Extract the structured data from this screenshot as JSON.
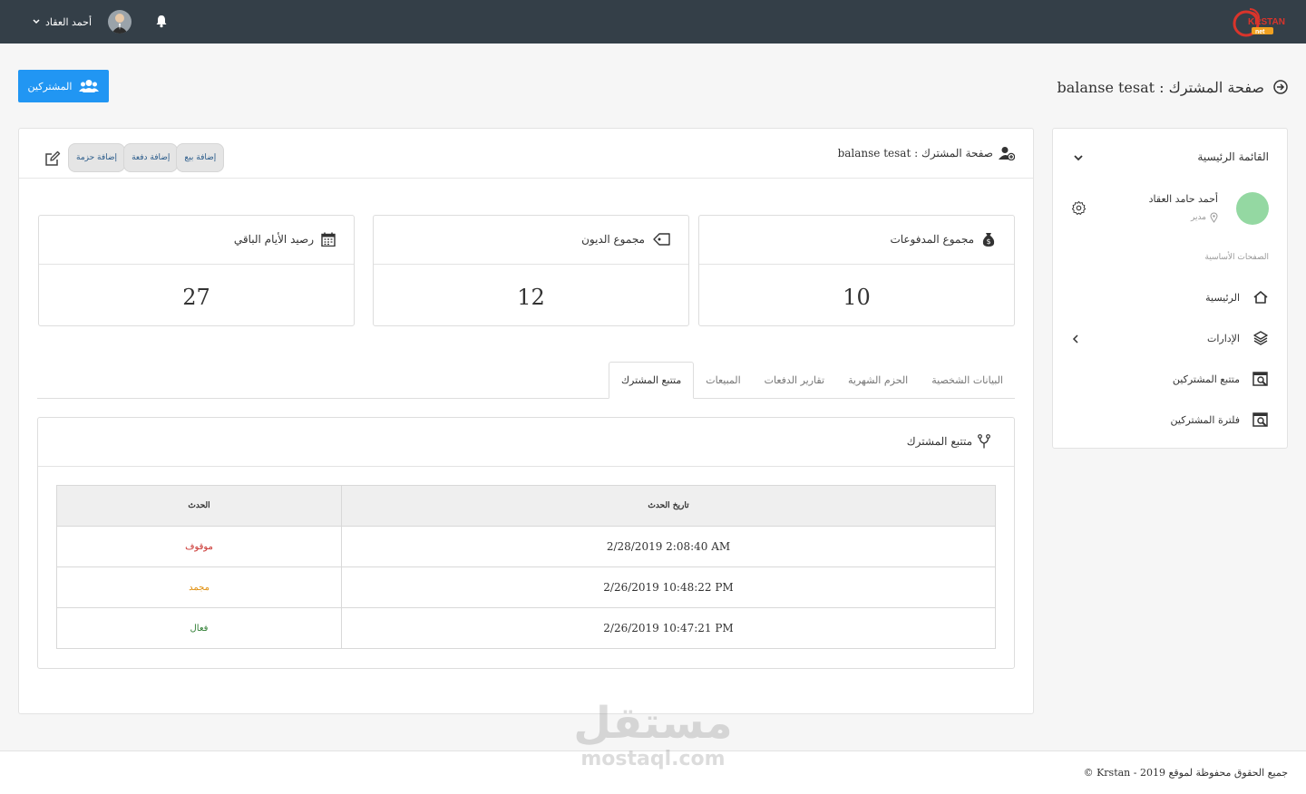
{
  "header": {
    "user_name": "أحمد العقاد",
    "logo_text": "KRSTAN",
    "logo_sub": "net"
  },
  "page": {
    "title": "صفحة المشترك : balanse tesat",
    "subscribers_button": "المشتركين"
  },
  "sidebar": {
    "heading": "القائمة الرئيسية",
    "user_name": "أحمد حامد العقاد",
    "user_role": "مدير",
    "section_label": "الصفحات الأساسية",
    "items": [
      {
        "label": "الرئيسية",
        "icon": "home-icon"
      },
      {
        "label": "الإدارات",
        "icon": "layers-icon"
      },
      {
        "label": "متتبع المشتركين",
        "icon": "search-box-icon"
      },
      {
        "label": "فلترة المشتركين",
        "icon": "search-box-icon"
      }
    ]
  },
  "main": {
    "title": "صفحة المشترك : balanse tesat",
    "actions": [
      "إضافة بيع",
      "إضافة دفعة",
      "إضافة حزمة"
    ]
  },
  "stats": [
    {
      "label": "مجموع المدفوعات",
      "value": "10",
      "icon": "money-bag-icon"
    },
    {
      "label": "مجموع الديون",
      "value": "12",
      "icon": "tag-icon"
    },
    {
      "label": "رصيد الأيام الباقي",
      "value": "27",
      "icon": "calendar-icon"
    }
  ],
  "tabs": [
    {
      "label": "البيانات الشخصية",
      "active": false
    },
    {
      "label": "الحزم الشهرية",
      "active": false
    },
    {
      "label": "تقارير الدفعات",
      "active": false
    },
    {
      "label": "المبيعات",
      "active": false
    },
    {
      "label": "متتبع المشترك",
      "active": true
    }
  ],
  "tracker": {
    "title": "متتبع المشترك",
    "columns": [
      "تاريخ الحدث",
      "الحدث"
    ],
    "rows": [
      {
        "date": "2/28/2019 2:08:40 AM",
        "event": "موقوف",
        "color": "#c9302c"
      },
      {
        "date": "2/26/2019 10:48:22 PM",
        "event": "مجمد",
        "color": "#e08e0b"
      },
      {
        "date": "2/26/2019 10:47:21 PM",
        "event": "فعال",
        "color": "#2e7d32"
      }
    ]
  },
  "footer": {
    "text": "جميع الحقوق محفوظة لموقع 2019 - Krstan ©"
  },
  "watermark": {
    "arabic": "مستقل",
    "latin": "mostaql.com"
  }
}
